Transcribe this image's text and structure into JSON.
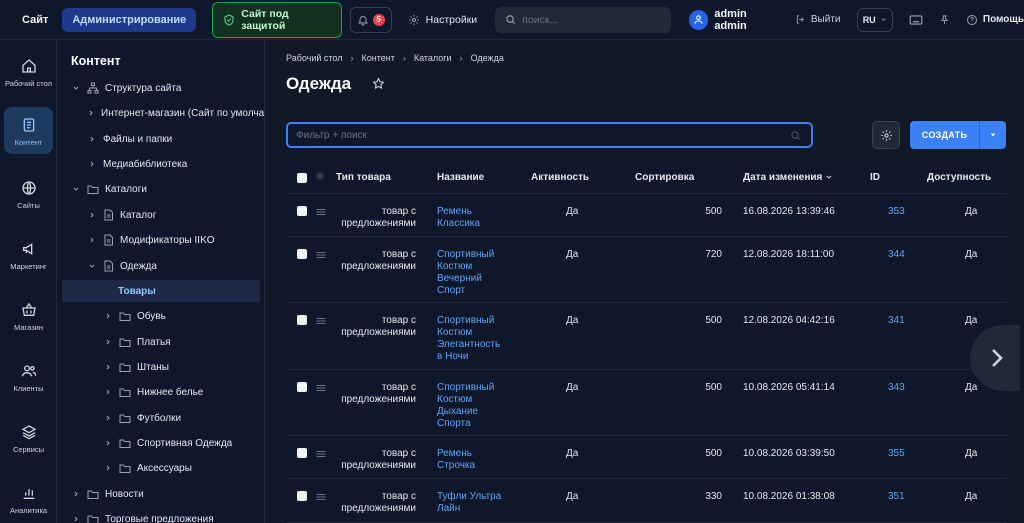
{
  "topbar": {
    "site_label": "Сайт",
    "admin_label": "Администрирование",
    "protected_label": "Сайт под защитой",
    "notifications_count": "5",
    "settings_label": "Настройки",
    "search_placeholder": "поиск...",
    "user_name": "admin admin",
    "logout_label": "Выйти",
    "lang": "RU",
    "help_label": "Помощь"
  },
  "rail": {
    "items": [
      {
        "label": "Рабочий стол",
        "icon": "home-icon"
      },
      {
        "label": "Контент",
        "icon": "document-icon"
      },
      {
        "label": "Сайты",
        "icon": "globe-icon"
      },
      {
        "label": "Маркетинг",
        "icon": "megaphone-icon"
      },
      {
        "label": "Магазин",
        "icon": "basket-icon"
      },
      {
        "label": "Клиенты",
        "icon": "users-icon"
      },
      {
        "label": "Сервисы",
        "icon": "layers-icon"
      },
      {
        "label": "Аналитика",
        "icon": "chart-icon"
      }
    ]
  },
  "tree": {
    "title": "Контент",
    "nodes": [
      {
        "label": "Структура сайта"
      },
      {
        "label": "Интернет-магазин (Сайт по умолчанию)"
      },
      {
        "label": "Файлы и папки"
      },
      {
        "label": "Медиабиблиотека"
      },
      {
        "label": "Каталоги"
      },
      {
        "label": "Каталог"
      },
      {
        "label": "Модификаторы IIKO"
      },
      {
        "label": "Одежда"
      },
      {
        "label": "Товары"
      },
      {
        "label": "Обувь"
      },
      {
        "label": "Платья"
      },
      {
        "label": "Штаны"
      },
      {
        "label": "Нижнее белье"
      },
      {
        "label": "Футболки"
      },
      {
        "label": "Спортивная Одежда"
      },
      {
        "label": "Аксессуары"
      },
      {
        "label": "Новости"
      },
      {
        "label": "Торговые предложения"
      }
    ]
  },
  "breadcrumbs": [
    "Рабочий стол",
    "Контент",
    "Каталоги",
    "Одежда"
  ],
  "page_title": "Одежда",
  "filter_placeholder": "Фильтр + поиск",
  "create_label": "СОЗДАТЬ",
  "table": {
    "headers": {
      "type": "Тип товара",
      "name": "Название",
      "active": "Активность",
      "sort": "Сортировка",
      "modified": "Дата изменения",
      "id": "ID",
      "available": "Доступность"
    },
    "rows": [
      {
        "type": "товар с предложениями",
        "name": "Ремень Классика",
        "active": "Да",
        "sort": "500",
        "modified": "16.08.2026 13:39:46",
        "id": "353",
        "available": "Да"
      },
      {
        "type": "товар с предложениями",
        "name": "Спортивный Костюм Вечерний Спорт",
        "active": "Да",
        "sort": "720",
        "modified": "12.08.2026 18:11:00",
        "id": "344",
        "available": "Да"
      },
      {
        "type": "товар с предложениями",
        "name": "Спортивный Костюм Элегантность в Ночи",
        "active": "Да",
        "sort": "500",
        "modified": "12.08.2026 04:42:16",
        "id": "341",
        "available": "Да"
      },
      {
        "type": "товар с предложениями",
        "name": "Спортивный Костюм Дыхание Спорта",
        "active": "Да",
        "sort": "500",
        "modified": "10.08.2026 05:41:14",
        "id": "343",
        "available": "Да"
      },
      {
        "type": "товар с предложениями",
        "name": "Ремень Строчка",
        "active": "Да",
        "sort": "500",
        "modified": "10.08.2026 03:39:50",
        "id": "355",
        "available": "Да"
      },
      {
        "type": "товар с предложениями",
        "name": "Туфли Ультра Лайн",
        "active": "Да",
        "sort": "330",
        "modified": "10.08.2026 01:38:08",
        "id": "351",
        "available": "Да"
      }
    ]
  }
}
